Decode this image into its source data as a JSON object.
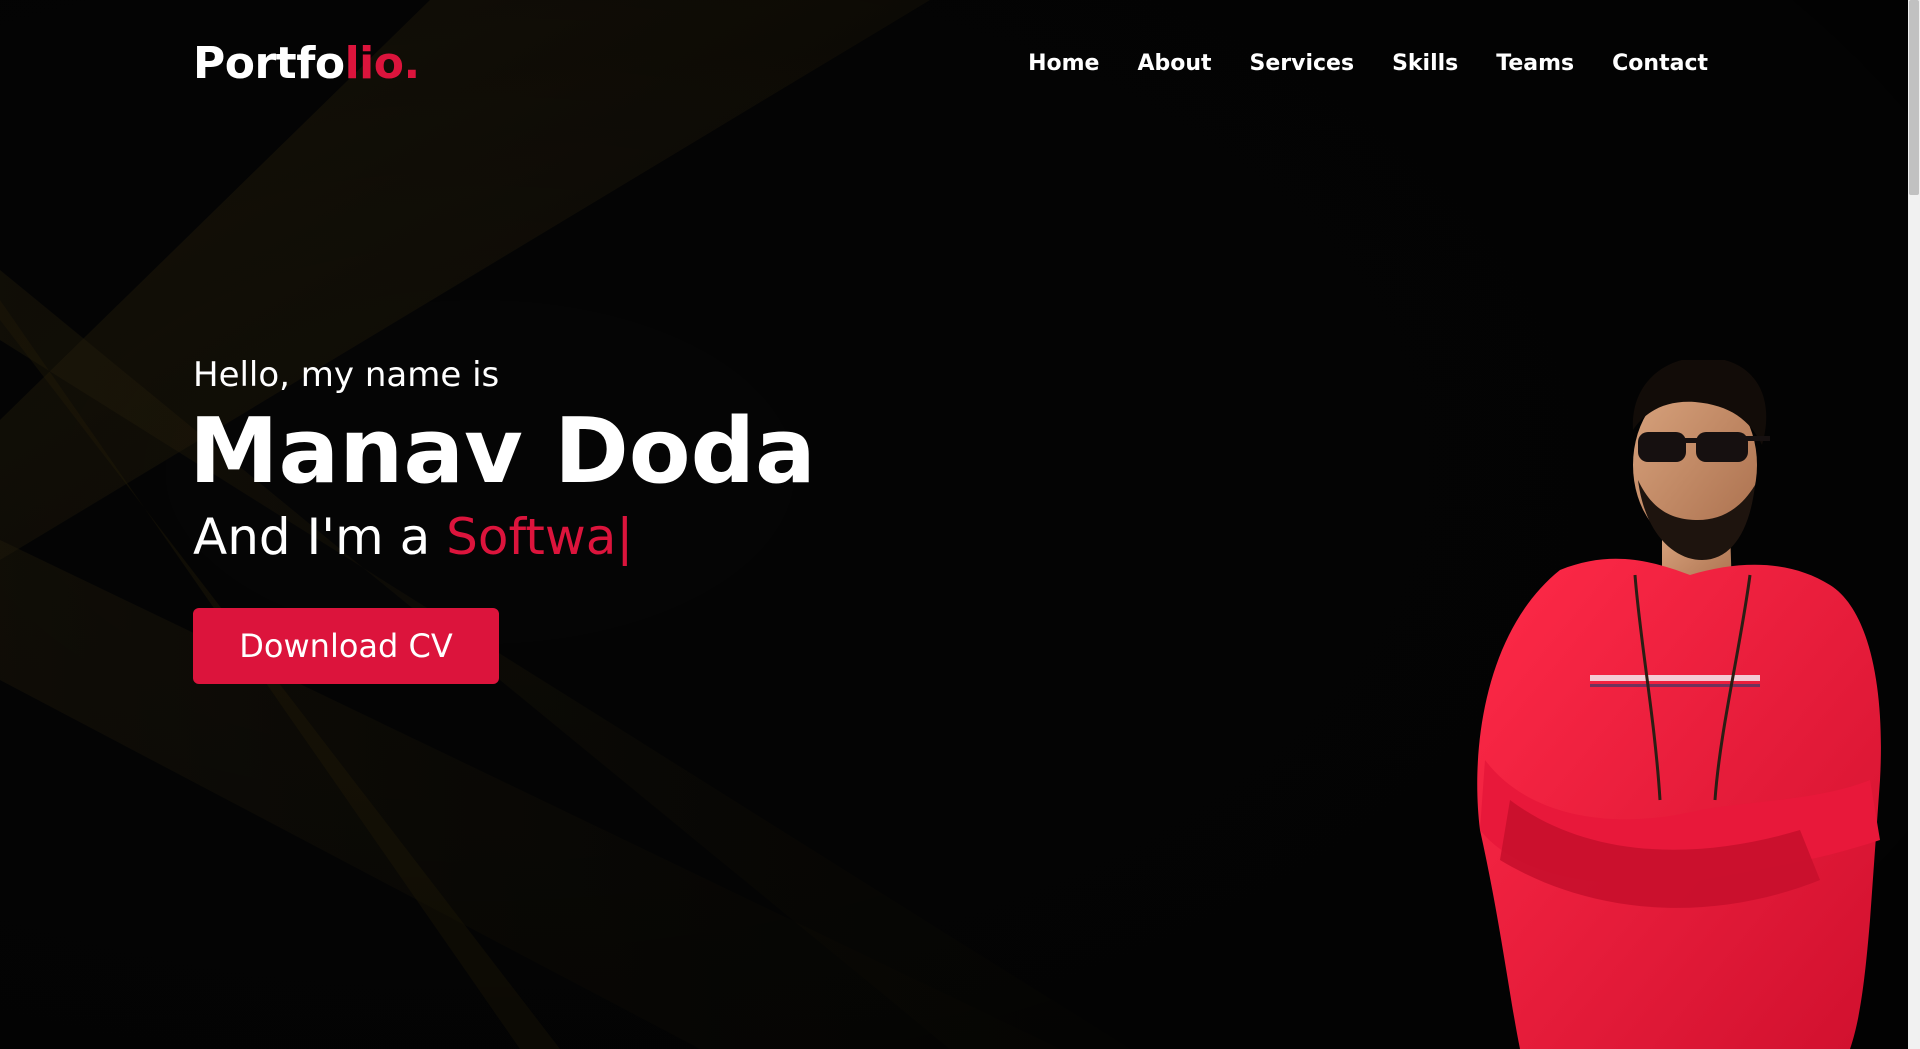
{
  "colors": {
    "accent": "#dc143c",
    "background": "#050505",
    "text": "#ffffff",
    "ray": "#3a2e10"
  },
  "logo": {
    "main": "Portfo",
    "accent": "lio."
  },
  "nav": {
    "items": [
      {
        "label": "Home"
      },
      {
        "label": "About"
      },
      {
        "label": "Services"
      },
      {
        "label": "Skills"
      },
      {
        "label": "Teams"
      },
      {
        "label": "Contact"
      }
    ]
  },
  "hero": {
    "greeting": "Hello, my name is",
    "name": "Manav Doda",
    "role_prefix": "And I'm a ",
    "role_typed": "Softwa",
    "cursor": "|",
    "button_label": "Download CV"
  },
  "portrait": {
    "icon": "person-photo"
  }
}
